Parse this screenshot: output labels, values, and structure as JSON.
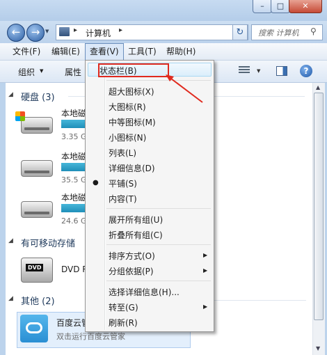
{
  "window": {
    "min": "–",
    "max": "□",
    "close": "✕"
  },
  "nav": {
    "back": "←",
    "forward": "→"
  },
  "address": {
    "sep1": "▸",
    "location": "计算机",
    "sep2": "▸",
    "drop": "▾"
  },
  "search": {
    "placeholder": "搜索 计算机",
    "icon": "⚲"
  },
  "refresh": "↻",
  "menubar": [
    "文件(F)",
    "编辑(E)",
    "查看(V)",
    "工具(T)",
    "帮助(H)"
  ],
  "toolbar": {
    "organize": "组织",
    "properties": "属性"
  },
  "groups": {
    "hdd": "硬盘 (3)",
    "removable": "有可移动存储",
    "other": "其他 (2)"
  },
  "drives": [
    {
      "name": "本地磁盘",
      "size": "3.35 GB"
    },
    {
      "name": "本地磁盘",
      "size": "35.5 GB"
    },
    {
      "name": "本地磁盘",
      "size": "24.6 GB"
    }
  ],
  "dvd": {
    "name": "DVD RW",
    "label": "DVD"
  },
  "cloud": {
    "name": "百度云管家",
    "desc": "双击运行百度云管家"
  },
  "view_menu": [
    {
      "label": "状态栏(B)"
    },
    {
      "label": "超大图标(X)"
    },
    {
      "label": "大图标(R)"
    },
    {
      "label": "中等图标(M)"
    },
    {
      "label": "小图标(N)"
    },
    {
      "label": "列表(L)"
    },
    {
      "label": "详细信息(D)"
    },
    {
      "label": "平铺(S)",
      "radio": "●"
    },
    {
      "label": "内容(T)"
    },
    {
      "label": "展开所有组(U)"
    },
    {
      "label": "折叠所有组(C)"
    },
    {
      "label": "排序方式(O)",
      "arrow": "▶"
    },
    {
      "label": "分组依据(P)",
      "arrow": "▶"
    },
    {
      "label": "选择详细信息(H)..."
    },
    {
      "label": "转至(G)",
      "arrow": "▶"
    },
    {
      "label": "刷新(R)"
    }
  ],
  "colors": {
    "highlight_box": "#e02a1e",
    "drive_bar": "#1f8fb9"
  }
}
